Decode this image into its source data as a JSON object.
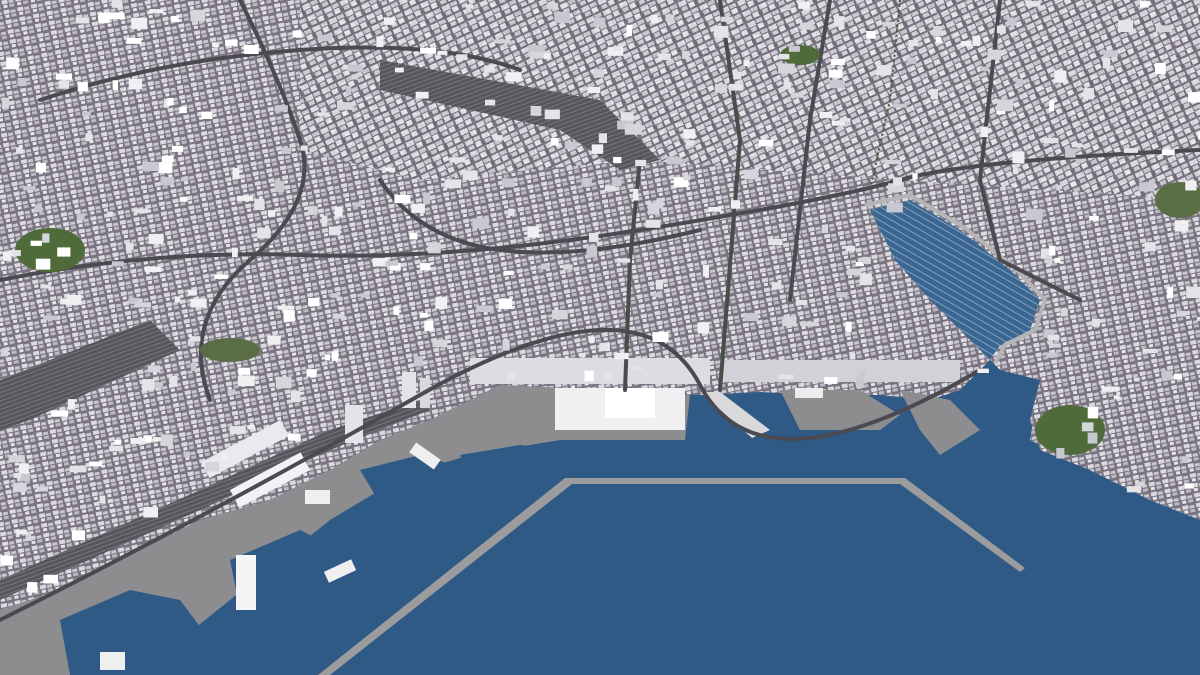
{
  "scene": {
    "description_free": true,
    "colors": {
      "sea": "#2f5a86",
      "sea_light": "#3d6b97",
      "marina_water": "#3a6690",
      "city_ground": "#6f6b74",
      "block_roof": "#d9d9de",
      "block_roof_alt": "#e8e8ec",
      "block_shadow": "#8a8590",
      "road": "#4a4a50",
      "rail": "#5a5a60",
      "dock": "#8d8d90",
      "pier": "#a7a7aa",
      "park": "#4f6b3a",
      "warehouse": "#eeeeee"
    }
  }
}
